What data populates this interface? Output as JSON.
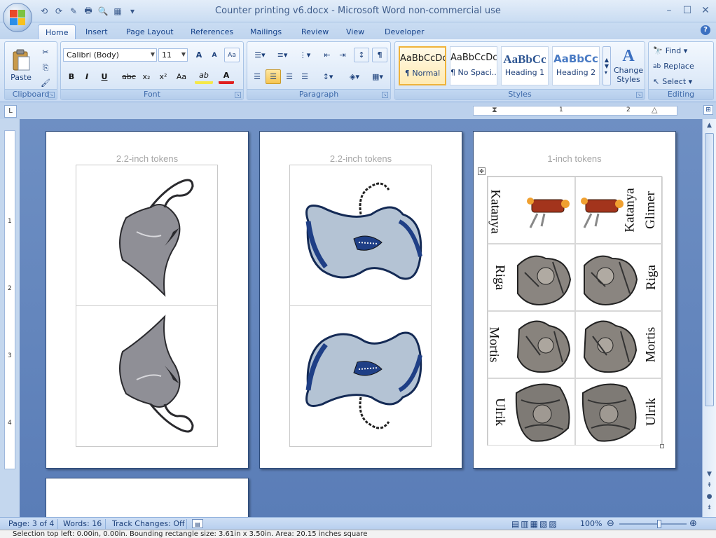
{
  "window": {
    "title": "Counter printing v6.docx - Microsoft Word non-commercial use",
    "minimize": "–",
    "maximize": "☐",
    "close": "✕"
  },
  "quick_access": [
    "⟲",
    "⟳",
    "✎",
    "🖶",
    "🔍",
    "▦",
    "▾"
  ],
  "tabs": [
    "Home",
    "Insert",
    "Page Layout",
    "References",
    "Mailings",
    "Review",
    "View",
    "Developer"
  ],
  "help_icon": "?",
  "clipboard": {
    "paste_label": "Paste",
    "group_label": "Clipboard"
  },
  "font": {
    "family": "Calibri (Body)",
    "size": "11",
    "grow": "A",
    "shrink": "A",
    "clear": "Aa",
    "bold": "B",
    "italic": "I",
    "underline": "U",
    "strike": "abc",
    "subscript": "x₂",
    "superscript": "x²",
    "change_case": "Aa",
    "highlight": "ab",
    "font_color": "A",
    "group_label": "Font"
  },
  "paragraph": {
    "show_marks": "¶",
    "group_label": "Paragraph"
  },
  "styles": {
    "items": [
      {
        "sample": "AaBbCcDc",
        "name": "¶ Normal"
      },
      {
        "sample": "AaBbCcDc",
        "name": "¶ No Spaci..."
      },
      {
        "sample": "AaBbCc",
        "name": "Heading 1"
      },
      {
        "sample": "AaBbCc",
        "name": "Heading 2"
      }
    ],
    "change_styles": "Change Styles",
    "group_label": "Styles"
  },
  "editing": {
    "find": "Find",
    "replace": "Replace",
    "select": "Select",
    "group_label": "Editing"
  },
  "ruler": {
    "tab_selector": "L",
    "horizontal_marks": [
      "1",
      "2"
    ],
    "vertical_marks": [
      "1",
      "2",
      "3",
      "4"
    ]
  },
  "pages": [
    {
      "heading": "2.2-inch tokens"
    },
    {
      "heading": "2.2-inch tokens"
    },
    {
      "heading": "1-inch tokens",
      "names": [
        "Katanya",
        "Glimer",
        "Riga",
        "Mortis",
        "Ulrik"
      ]
    }
  ],
  "statusbar": {
    "page": "Page: 3 of 4",
    "words": "Words: 16",
    "track_changes": "Track Changes: Off",
    "zoom": "100%",
    "zoom_level": 1.0
  },
  "bottom_line": "Selection top left: 0.00in, 0.00in. Bounding rectangle size: 3.61in x 3.50in. Area: 20.15 inches square",
  "colors": {
    "workspace": "#6e8fc3",
    "ribbon": "#dde9f8",
    "accent": "#15428b"
  }
}
